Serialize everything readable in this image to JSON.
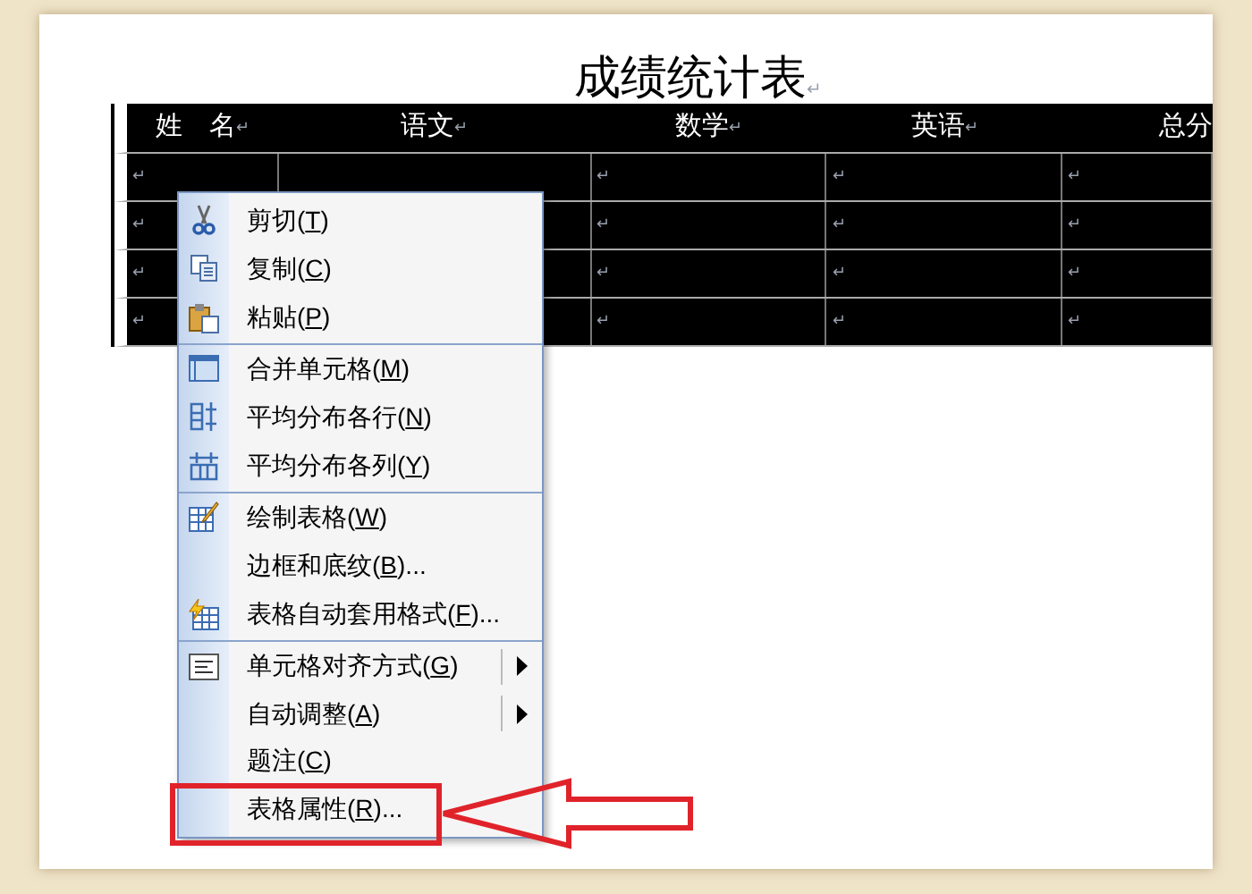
{
  "document": {
    "title": "成绩统计表",
    "title_mark": "↵"
  },
  "table": {
    "columns": [
      {
        "text": "姓　名",
        "mark": "↵"
      },
      {
        "text": "语文",
        "mark": "↵"
      },
      {
        "text": "数学",
        "mark": "↵"
      },
      {
        "text": "英语",
        "mark": "↵"
      },
      {
        "text": "总分"
      }
    ],
    "rows": [
      {
        "cells": [
          "↵",
          null,
          "↵",
          "↵",
          "↵"
        ]
      },
      {
        "cells": [
          "↵",
          null,
          "↵",
          "↵",
          "↵"
        ]
      },
      {
        "cells": [
          "↵",
          null,
          "↵",
          "↵",
          "↵"
        ]
      },
      {
        "cells": [
          "↵",
          null,
          "↵",
          "↵",
          "↵"
        ]
      }
    ]
  },
  "context_menu": {
    "items": [
      {
        "label": "剪切(T)",
        "kind": "scissors",
        "submenu": false,
        "separator_after": false,
        "highlighted": false
      },
      {
        "label": "复制(C)",
        "kind": "copy",
        "submenu": false,
        "separator_after": false,
        "highlighted": false
      },
      {
        "label": "粘贴(P)",
        "kind": "paste",
        "submenu": false,
        "separator_after": true,
        "highlighted": false
      },
      {
        "label": "合并单元格(M)",
        "kind": "merge",
        "submenu": false,
        "separator_after": false,
        "highlighted": false
      },
      {
        "label": "平均分布各行(N)",
        "kind": "rows",
        "submenu": false,
        "separator_after": false,
        "highlighted": false
      },
      {
        "label": "平均分布各列(Y)",
        "kind": "columns",
        "submenu": false,
        "separator_after": true,
        "highlighted": false
      },
      {
        "label": "绘制表格(W)",
        "kind": "pencil",
        "submenu": false,
        "separator_after": false,
        "highlighted": false
      },
      {
        "label": "边框和底纹(B)...",
        "kind": "plain",
        "submenu": false,
        "separator_after": false,
        "highlighted": false
      },
      {
        "label": "表格自动套用格式(F)...",
        "kind": "autoformat",
        "submenu": false,
        "separator_after": true,
        "highlighted": false
      },
      {
        "label": "单元格对齐方式(G)",
        "kind": "align",
        "submenu": true,
        "separator_after": false,
        "highlighted": false
      },
      {
        "label": "自动调整(A)",
        "kind": "plain",
        "submenu": true,
        "separator_after": false,
        "highlighted": false
      },
      {
        "label": "题注(C)",
        "kind": "plain",
        "submenu": false,
        "separator_after": false,
        "highlighted": false
      },
      {
        "label": "表格属性(R)...",
        "kind": "plain",
        "submenu": false,
        "separator_after": false,
        "highlighted": true
      }
    ]
  }
}
